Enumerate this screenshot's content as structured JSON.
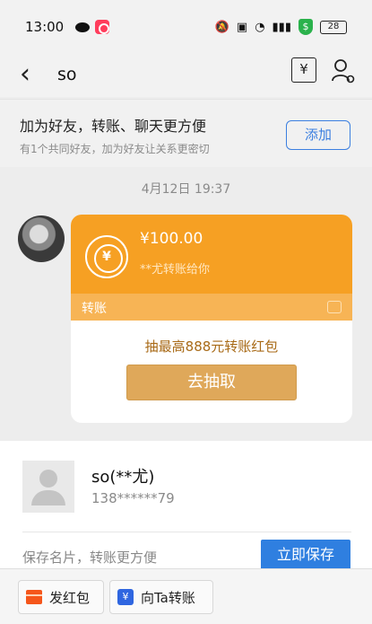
{
  "status_bar": {
    "time": "13:00",
    "battery": "28",
    "security_badge": "$"
  },
  "nav": {
    "back_icon": "chevron-left-icon",
    "title": "so",
    "transfer_icon_glyph": "¥"
  },
  "add_friend_bar": {
    "title": "加为好友，转账、聊天更方便",
    "subtitle": "有1个共同好友，加为好友让关系更密切",
    "button_label": "添加"
  },
  "chat": {
    "timestamp": "4月12日 19:37",
    "transfer_card": {
      "amount": "¥100.00",
      "from_text": "**尤转账给你",
      "coin_glyph": "¥",
      "band_label": "转账",
      "promo_text": "抽最高888元转账红包",
      "draw_button_label": "去抽取",
      "colors": {
        "top": "#f6a023",
        "band": "#f7b455",
        "button": "#dfa85a"
      }
    }
  },
  "contact_card": {
    "name": "so(**尤)",
    "phone": "138******79",
    "save_hint": "保存名片，转账更方便",
    "save_button_label": "立即保存",
    "accent": "#2f7fe0"
  },
  "bottom_actions": {
    "red_packet_label": "发红包",
    "transfer_label": "向Ta转账",
    "transfer_icon_glyph": "¥"
  }
}
